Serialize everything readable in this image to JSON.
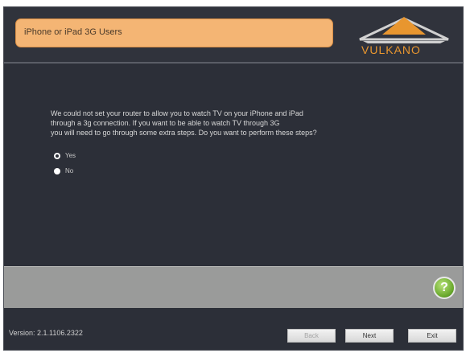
{
  "header": {
    "title": "iPhone or iPad 3G Users",
    "logo_text": "VULKANO"
  },
  "content": {
    "message_lines": [
      "We could not set your router to allow you to watch TV on your iPhone and iPad",
      "through a 3g connection. If you want to be able to watch TV through 3G",
      "you will need to go through some extra steps. Do you want to perform these steps?"
    ],
    "options": [
      {
        "label": "Yes",
        "selected": true
      },
      {
        "label": "No",
        "selected": false
      }
    ]
  },
  "help": {
    "glyph": "?"
  },
  "footer": {
    "version": "Version: 2.1.1106.2322",
    "back_label": "Back",
    "next_label": "Next",
    "exit_label": "Exit"
  },
  "colors": {
    "background": "#2c2f38",
    "title_box": "#f4b574",
    "accent": "#e8962f",
    "gray_bar": "#9a9b9a",
    "help_green": "#6aa92d"
  }
}
